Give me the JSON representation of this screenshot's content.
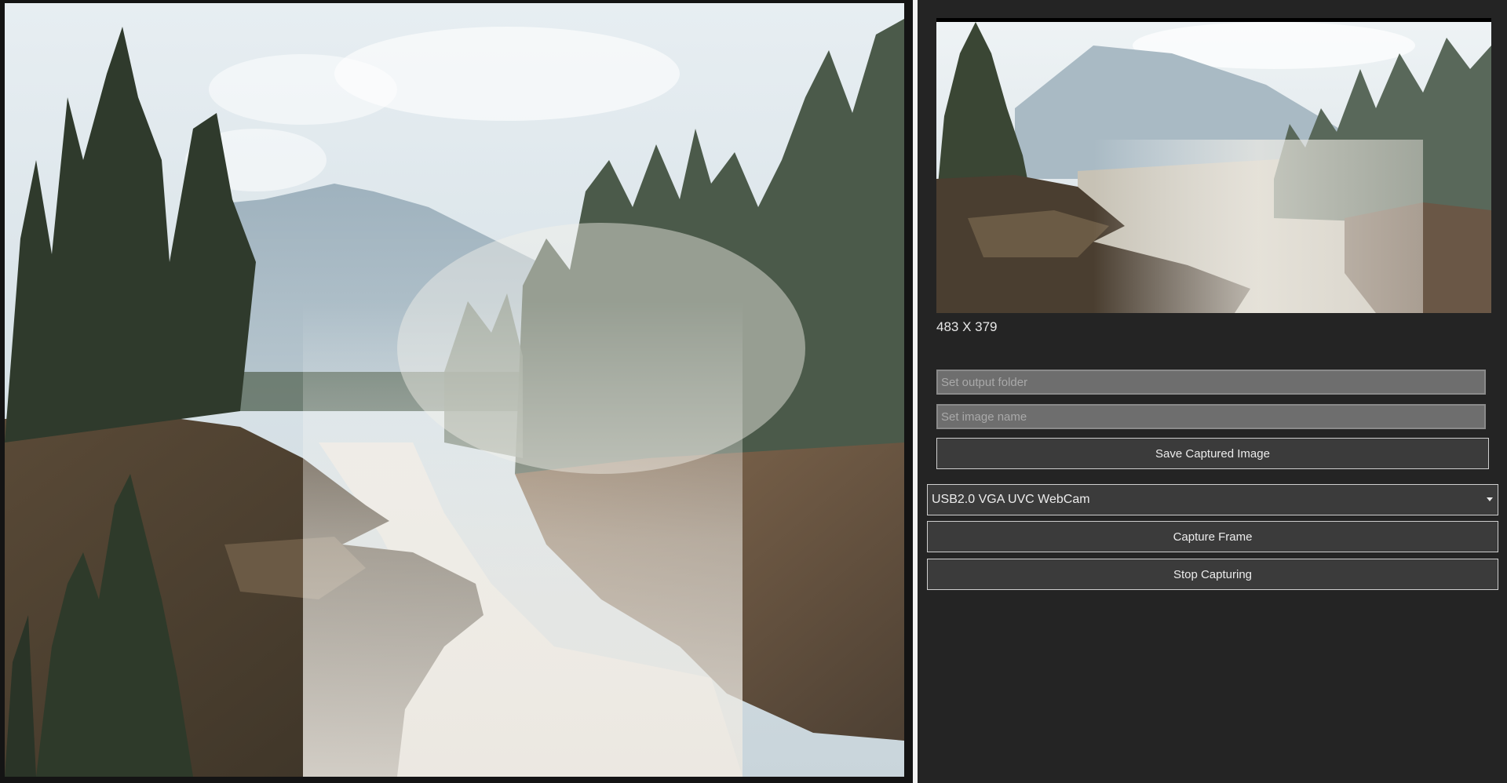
{
  "preview": {
    "dimensions": "483 X 379"
  },
  "output": {
    "folder_placeholder": "Set output folder",
    "folder_value": "",
    "name_placeholder": "Set image name",
    "name_value": "",
    "save_label": "Save Captured Image"
  },
  "camera": {
    "selected_device": "USB2.0 VGA UVC WebCam",
    "capture_label": "Capture Frame",
    "stop_label": "Stop Capturing"
  },
  "icons": {
    "dropdown": "chevron-down-icon"
  },
  "colors": {
    "background": "#242424",
    "button": "#3b3b3b",
    "button_border": "#cfcfcf",
    "input": "#6e6e6e"
  }
}
